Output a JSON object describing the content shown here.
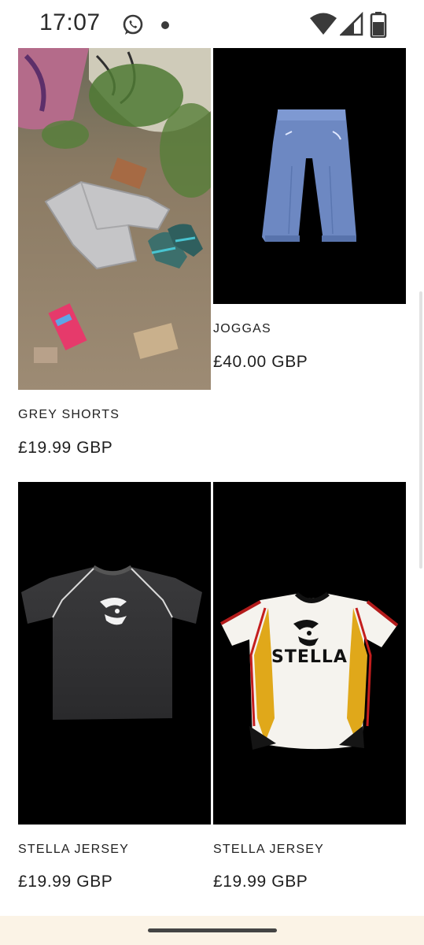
{
  "status_bar": {
    "time": "17:07",
    "icons": [
      "whatsapp-icon",
      "notification-dot",
      "wifi-icon",
      "cell-signal-icon",
      "battery-icon"
    ]
  },
  "products": [
    {
      "title": "GREY SHORTS",
      "price": "£19.99 GBP",
      "image": "grey-shorts-photo"
    },
    {
      "title": "JOGGAS",
      "price": "£40.00 GBP",
      "image": "blue-joggers-photo"
    },
    {
      "title": "STELLA JERSEY",
      "price": "£19.99 GBP",
      "image": "black-jersey-photo"
    },
    {
      "title": "STELLA JERSEY",
      "price": "£19.99 GBP",
      "image": "white-jersey-photo"
    }
  ],
  "jersey_print": "STELLA",
  "colors": {
    "background": "#ffffff",
    "image_bg": "#000000",
    "nav_bar": "#fbf3e6"
  }
}
